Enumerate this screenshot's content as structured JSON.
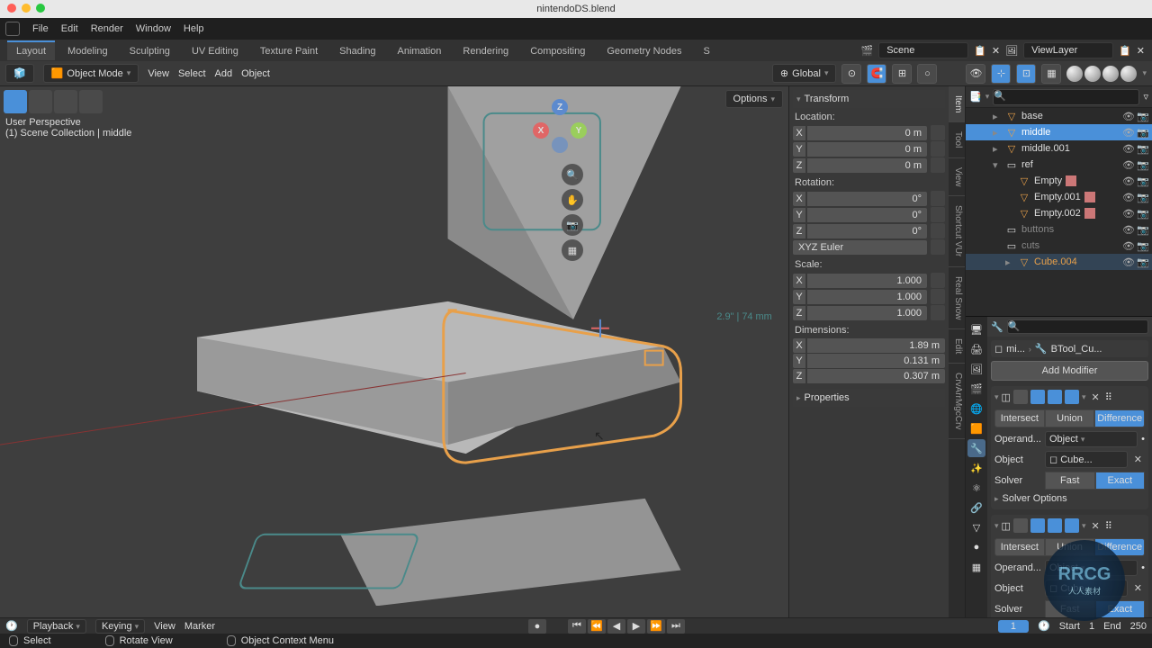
{
  "title": "nintendoDS.blend",
  "menubar": [
    "File",
    "Edit",
    "Render",
    "Window",
    "Help"
  ],
  "workspaces": [
    "Layout",
    "Modeling",
    "Sculpting",
    "UV Editing",
    "Texture Paint",
    "Shading",
    "Animation",
    "Rendering",
    "Compositing",
    "Geometry Nodes",
    "S"
  ],
  "active_workspace": "Layout",
  "scene": "Scene",
  "viewlayer": "ViewLayer",
  "header": {
    "mode": "Object Mode",
    "view": "View",
    "select": "Select",
    "add": "Add",
    "object": "Object",
    "orientation": "Global",
    "options": "Options"
  },
  "viewport": {
    "line1": "User Perspective",
    "line2": "(1) Scene Collection | middle",
    "axes": {
      "x": "X",
      "y": "Y",
      "z": "Z"
    },
    "blueprint_dim": "2.9\" | 74 mm"
  },
  "npanel": {
    "tabs": [
      "Item",
      "Tool",
      "View",
      "Shortcut VUr",
      "Real Snow",
      "Edit",
      "CrvArrMgcCrv"
    ],
    "active_tab": "Item",
    "transform": "Transform",
    "location": "Location:",
    "rotation": "Rotation:",
    "rot_mode": "XYZ Euler",
    "scale": "Scale:",
    "dimensions": "Dimensions:",
    "properties": "Properties",
    "loc": {
      "x": "0 m",
      "y": "0 m",
      "z": "0 m"
    },
    "rot": {
      "x": "0°",
      "y": "0°",
      "z": "0°"
    },
    "scl": {
      "x": "1.000",
      "y": "1.000",
      "z": "1.000"
    },
    "dim": {
      "x": "1.89 m",
      "y": "0.131 m",
      "z": "0.307 m"
    },
    "axis_labels": {
      "x": "X",
      "y": "Y",
      "z": "Z"
    }
  },
  "outliner": {
    "items": [
      {
        "name": "base",
        "type": "mesh",
        "indent": 1,
        "sel": false
      },
      {
        "name": "middle",
        "type": "mesh",
        "indent": 1,
        "sel": true
      },
      {
        "name": "middle.001",
        "type": "mesh",
        "indent": 1,
        "sel": false
      },
      {
        "name": "ref",
        "type": "coll",
        "indent": 1,
        "sel": false,
        "expand": true
      },
      {
        "name": "Empty",
        "type": "empty",
        "indent": 2,
        "sel": false,
        "img": true
      },
      {
        "name": "Empty.001",
        "type": "empty",
        "indent": 2,
        "sel": false,
        "img": true
      },
      {
        "name": "Empty.002",
        "type": "empty",
        "indent": 2,
        "sel": false,
        "img": true
      },
      {
        "name": "buttons",
        "type": "coll",
        "indent": 1,
        "sel": false,
        "muted": true
      },
      {
        "name": "cuts",
        "type": "coll",
        "indent": 1,
        "sel": false,
        "muted": true
      },
      {
        "name": "Cube.004",
        "type": "mesh",
        "indent": 2,
        "sel": false,
        "hl": true
      }
    ]
  },
  "props": {
    "crumb": [
      "mi...",
      "BTool_Cu..."
    ],
    "add_modifier": "Add Modifier",
    "mod_ops": [
      "Intersect",
      "Union",
      "Difference"
    ],
    "operand_label": "Operand...",
    "operand_value": "Object",
    "object_label": "Object",
    "object_value": "Cube...",
    "solver_label": "Solver",
    "solver_ops": [
      "Fast",
      "Exact"
    ],
    "solver_options": "Solver Options"
  },
  "timeline": {
    "playback": "Playback",
    "keying": "Keying",
    "view": "View",
    "marker": "Marker",
    "frame": "1",
    "start_label": "Start",
    "start": "1",
    "end_label": "End",
    "end": "250"
  },
  "status": {
    "select": "Select",
    "rotate": "Rotate View",
    "context": "Object Context Menu"
  },
  "watermark": {
    "big": "RRCG",
    "sm": "人人素材"
  }
}
